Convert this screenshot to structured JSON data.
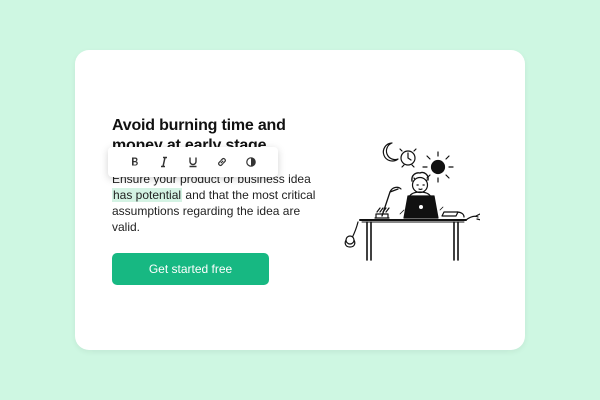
{
  "hero": {
    "title": "Avoid burning time and money at early stage",
    "body_before": "Ensure your product or business idea ",
    "body_highlight": "has potential",
    "body_after": " and that the most critical assumptions regarding the idea are valid.",
    "cta_label": "Get started free"
  },
  "toolbar": {
    "items": [
      {
        "icon": "bold-icon"
      },
      {
        "icon": "italic-icon"
      },
      {
        "icon": "underline-icon"
      },
      {
        "icon": "link-icon"
      },
      {
        "icon": "contrast-icon"
      }
    ]
  },
  "colors": {
    "background": "#cef7e2",
    "card": "#ffffff",
    "accent": "#17b882",
    "highlight": "#d4f3e4"
  }
}
